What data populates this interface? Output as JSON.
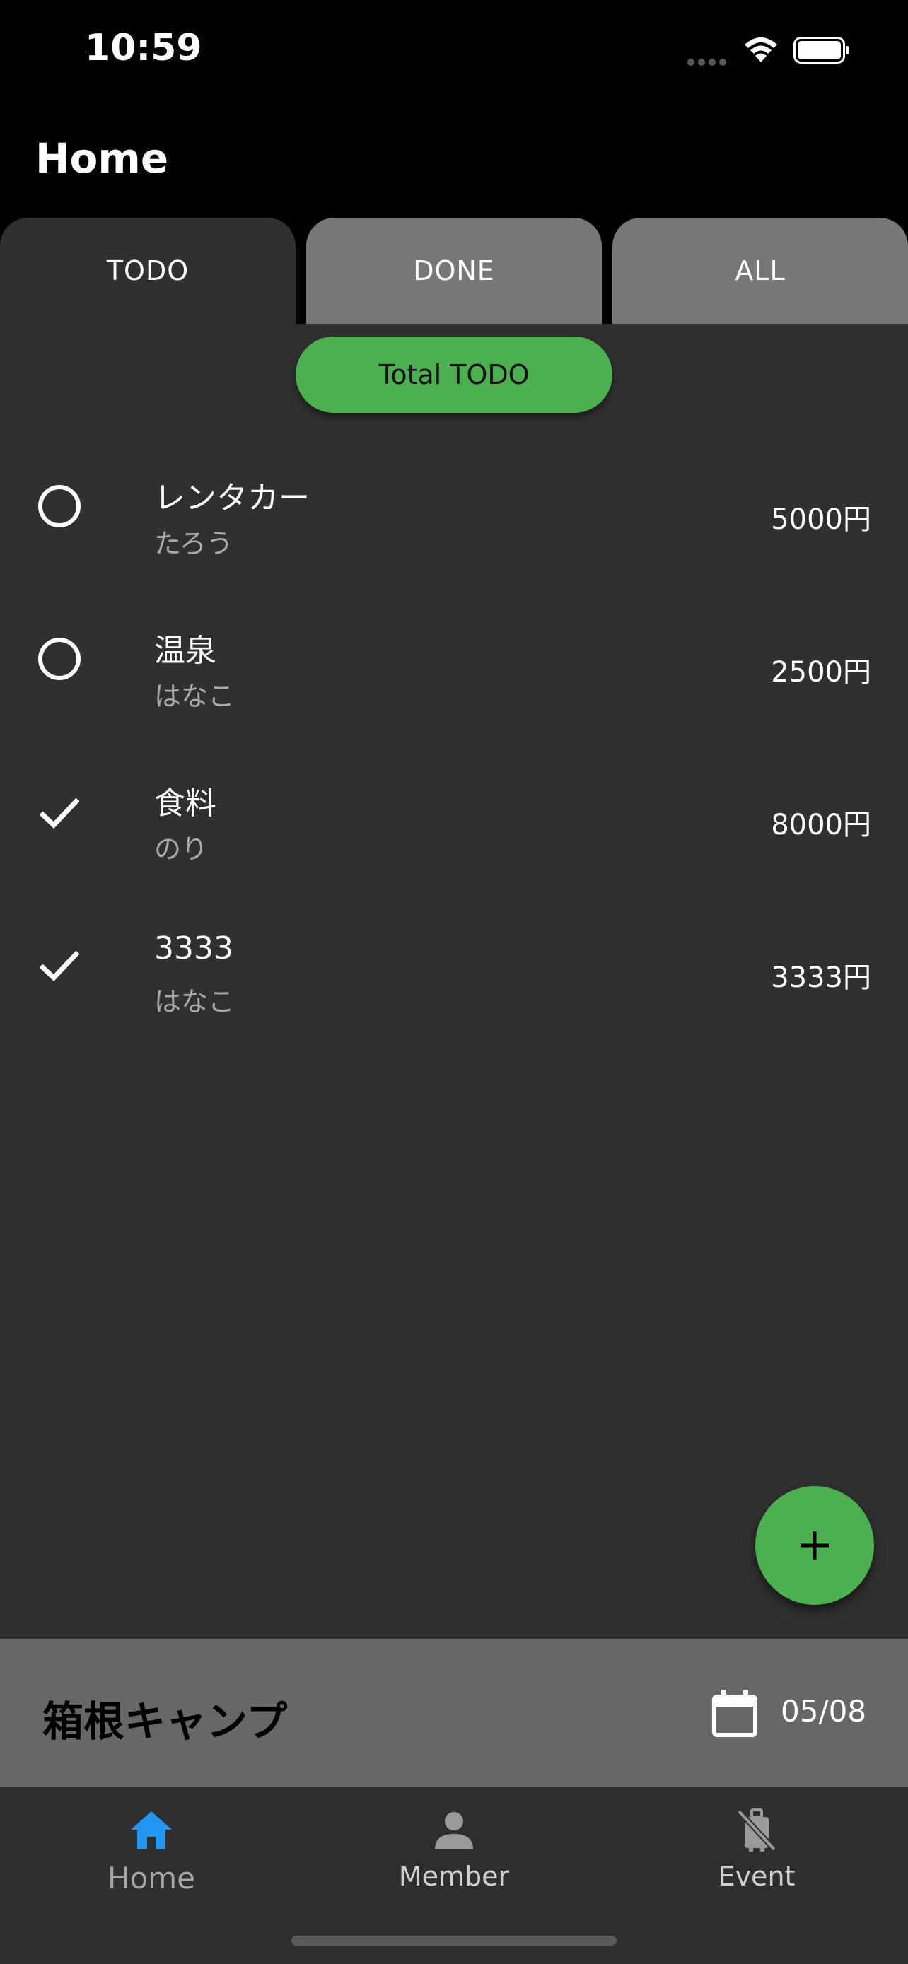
{
  "status_bar": {
    "time": "10:59"
  },
  "app_bar": {
    "title": "Home"
  },
  "tabs": [
    {
      "label": "TODO",
      "active": true
    },
    {
      "label": "DONE",
      "active": false
    },
    {
      "label": "ALL",
      "active": false
    }
  ],
  "total_chip": {
    "label": "Total TODO"
  },
  "items": [
    {
      "title": "レンタカー",
      "member": "たろう",
      "amount": "5000円",
      "status": "circle-icon"
    },
    {
      "title": "温泉",
      "member": "はなこ",
      "amount": "2500円",
      "status": "circle-icon"
    },
    {
      "title": "食料",
      "member": "のり",
      "amount": "8000円",
      "status": "check-icon"
    },
    {
      "title": "3333",
      "member": "はなこ",
      "amount": "3333円",
      "status": "check-icon"
    }
  ],
  "fab": {
    "icon": "plus-icon"
  },
  "event": {
    "name": "箱根キャンプ",
    "date": "05/08",
    "icon": "calendar-icon"
  },
  "bottom_nav": [
    {
      "label": "Home",
      "icon": "home-icon",
      "active": true
    },
    {
      "label": "Member",
      "icon": "person-icon",
      "active": false
    },
    {
      "label": "Event",
      "icon": "luggage-off-icon",
      "active": false
    }
  ],
  "colors": {
    "accent": "#4caf50",
    "nav_active": "#2196f3",
    "surface": "#303030",
    "tab_inactive": "#777777",
    "event_bar": "#676767"
  }
}
